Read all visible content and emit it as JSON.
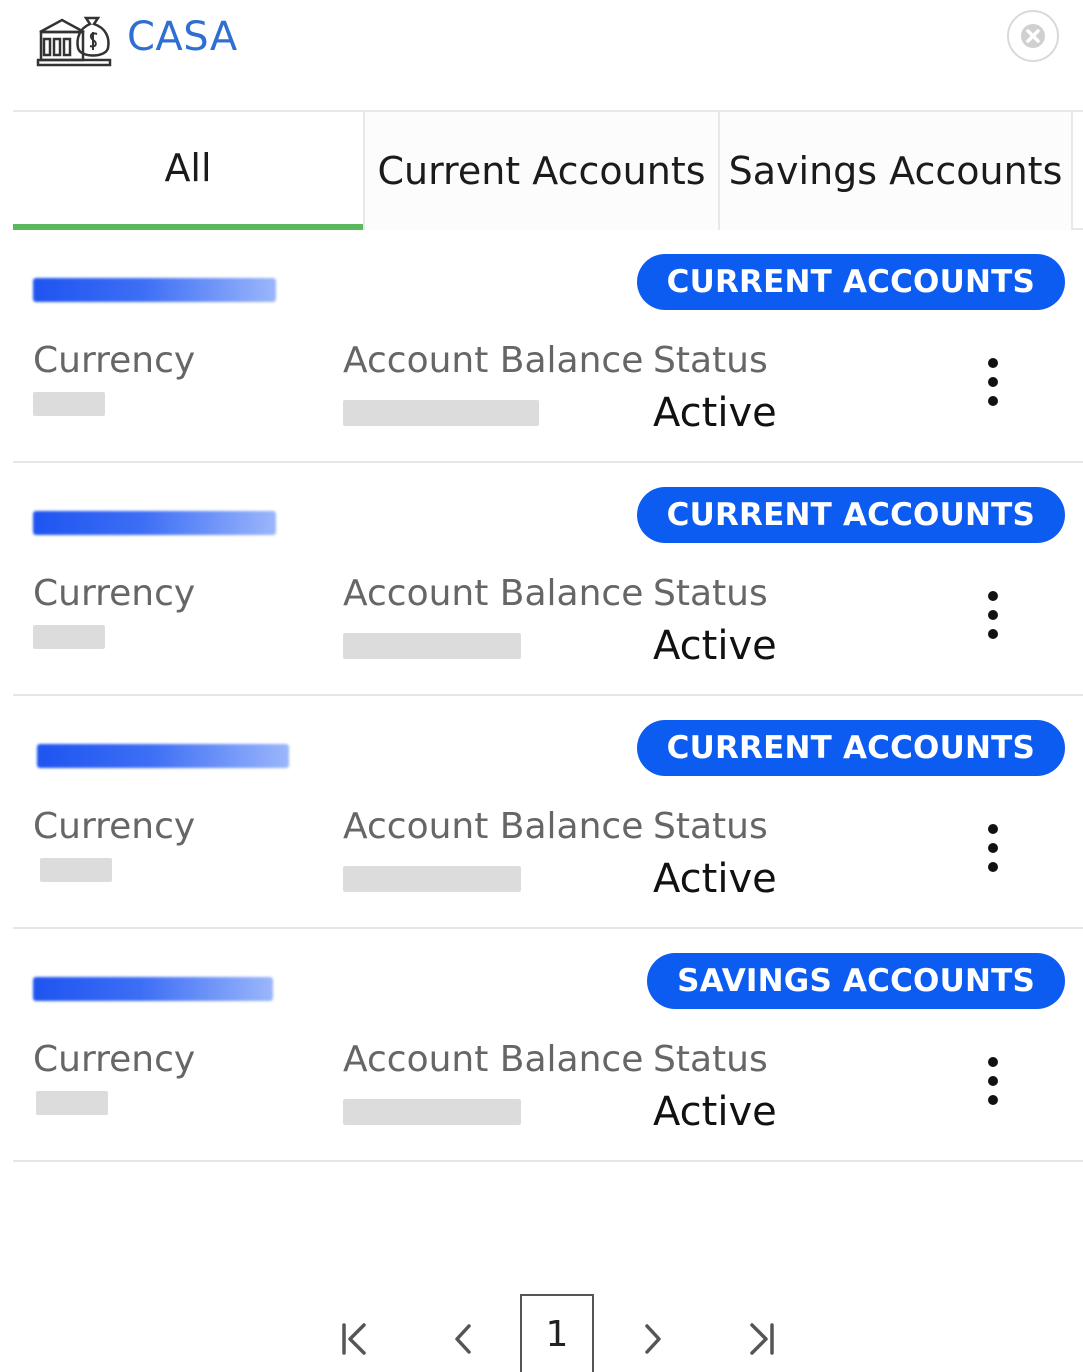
{
  "header": {
    "title": "CASA",
    "app_icon": "bank-building-money-bag-icon",
    "close_icon": "close-circle-icon"
  },
  "tabs": [
    {
      "label": "All",
      "active": true
    },
    {
      "label": "Current Accounts",
      "active": false
    },
    {
      "label": "Savings Accounts",
      "active": false
    }
  ],
  "accounts": [
    {
      "type_badge": "CURRENT ACCOUNTS",
      "currency_label": "Currency",
      "balance_label": "Account Balance",
      "status_label": "Status",
      "status": "Active"
    },
    {
      "type_badge": "CURRENT ACCOUNTS",
      "currency_label": "Currency",
      "balance_label": "Account Balance",
      "status_label": "Status",
      "status": "Active"
    },
    {
      "type_badge": "CURRENT ACCOUNTS",
      "currency_label": "Currency",
      "balance_label": "Account Balance",
      "status_label": "Status",
      "status": "Active"
    },
    {
      "type_badge": "SAVINGS ACCOUNTS",
      "currency_label": "Currency",
      "balance_label": "Account Balance",
      "status_label": "Status",
      "status": "Active"
    }
  ],
  "pagination": {
    "current_page": "1",
    "first_icon": "first-page-icon",
    "prev_icon": "chevron-left-icon",
    "next_icon": "chevron-right-icon",
    "last_icon": "last-page-icon"
  },
  "colors": {
    "title": "#2f6fd3",
    "badge": "#0d5cf2",
    "active_tab_underline": "#5cb85c"
  }
}
